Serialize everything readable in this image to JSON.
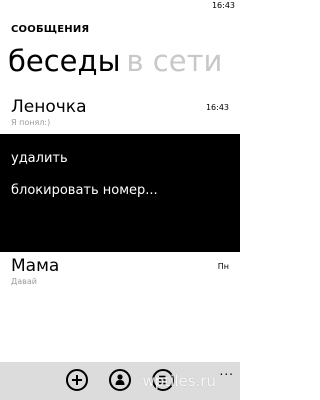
{
  "status_bar": {
    "time": "16:43"
  },
  "app": {
    "title": "СООБЩЕНИЯ"
  },
  "pivot": {
    "items": [
      {
        "label": "беседы",
        "active": true
      },
      {
        "label": "в сети",
        "active": false
      }
    ]
  },
  "threads": [
    {
      "name": "Леночка",
      "preview": "Я понял:)",
      "time": "16:43"
    },
    {
      "name": "Мама",
      "preview": "Давай",
      "time": "Пн"
    }
  ],
  "context_menu": {
    "items": [
      {
        "label": "удалить"
      },
      {
        "label": "блокировать номер..."
      }
    ]
  },
  "app_bar": {
    "buttons": [
      {
        "icon": "plus-icon"
      },
      {
        "icon": "contact-icon"
      },
      {
        "icon": "list-select-icon"
      }
    ],
    "more": "..."
  },
  "watermark": "wptiles.ru"
}
